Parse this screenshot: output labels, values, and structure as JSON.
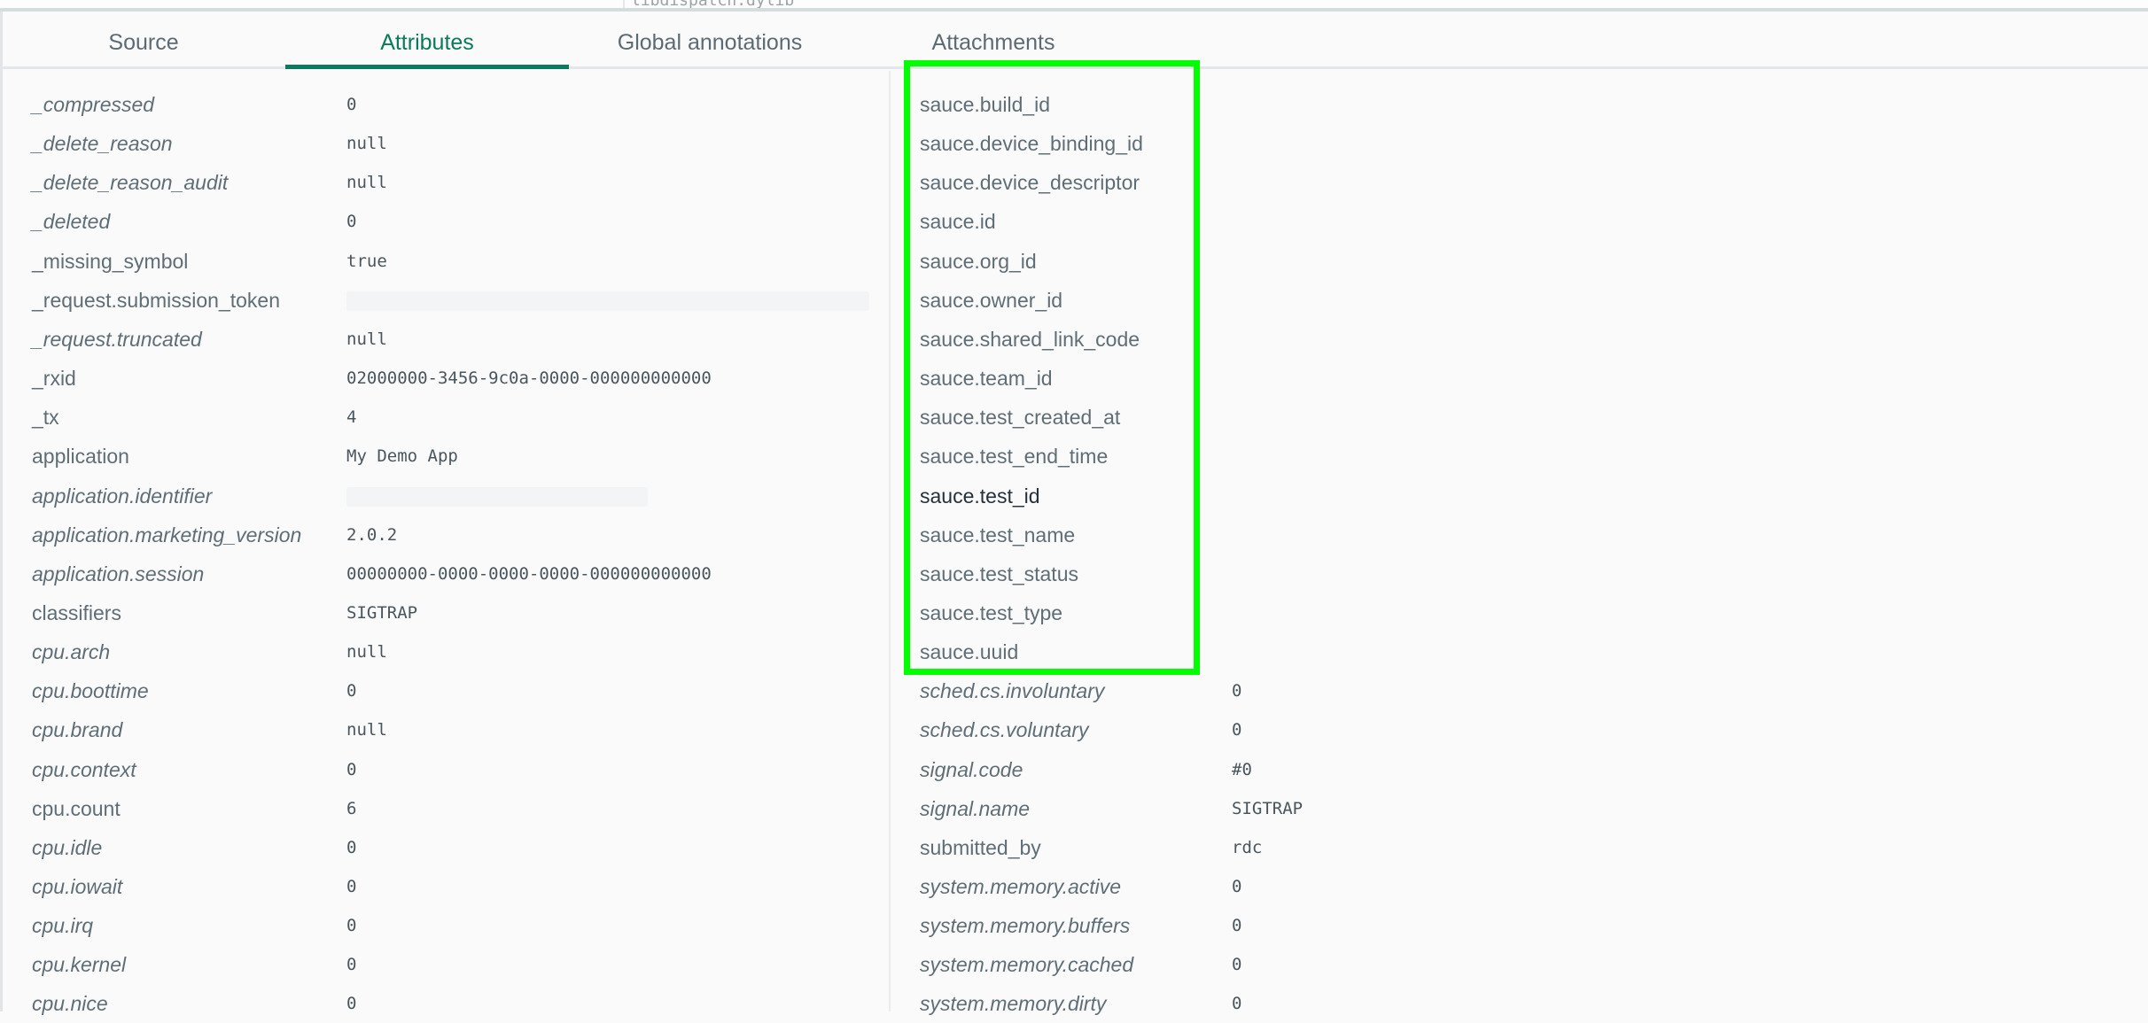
{
  "top_strip": {
    "clipped_text": "libdispatch.dylib"
  },
  "tabs": [
    {
      "label": "Source",
      "active": false
    },
    {
      "label": "Attributes",
      "active": true
    },
    {
      "label": "Global annotations",
      "active": false
    },
    {
      "label": "Attachments",
      "active": false
    }
  ],
  "colors": {
    "accent": "#0b7a5c",
    "highlight": "#00ff00"
  },
  "left_attributes": [
    {
      "key": "_compressed",
      "value": "0",
      "italic": true
    },
    {
      "key": "_delete_reason",
      "value": "null",
      "italic": true
    },
    {
      "key": "_delete_reason_audit",
      "value": "null",
      "italic": true
    },
    {
      "key": "_deleted",
      "value": "0",
      "italic": true
    },
    {
      "key": "_missing_symbol",
      "value": "true",
      "italic": false
    },
    {
      "key": "_request.submission_token",
      "value": null,
      "redacted": true,
      "italic": false
    },
    {
      "key": "_request.truncated",
      "value": "null",
      "italic": true
    },
    {
      "key": "_rxid",
      "value": "02000000-3456-9c0a-0000-000000000000",
      "italic": false
    },
    {
      "key": "_tx",
      "value": "4",
      "italic": false
    },
    {
      "key": "application",
      "value": "My Demo App",
      "italic": false
    },
    {
      "key": "application.identifier",
      "value": null,
      "redacted": true,
      "italic": true
    },
    {
      "key": "application.marketing_version",
      "value": "2.0.2",
      "italic": true
    },
    {
      "key": "application.session",
      "value": "00000000-0000-0000-0000-000000000000",
      "italic": true
    },
    {
      "key": "classifiers",
      "value": "SIGTRAP",
      "italic": false
    },
    {
      "key": "cpu.arch",
      "value": "null",
      "italic": true
    },
    {
      "key": "cpu.boottime",
      "value": "0",
      "italic": true
    },
    {
      "key": "cpu.brand",
      "value": "null",
      "italic": true
    },
    {
      "key": "cpu.context",
      "value": "0",
      "italic": true
    },
    {
      "key": "cpu.count",
      "value": "6",
      "italic": false
    },
    {
      "key": "cpu.idle",
      "value": "0",
      "italic": true
    },
    {
      "key": "cpu.iowait",
      "value": "0",
      "italic": true
    },
    {
      "key": "cpu.irq",
      "value": "0",
      "italic": true
    },
    {
      "key": "cpu.kernel",
      "value": "0",
      "italic": true
    },
    {
      "key": "cpu.nice",
      "value": "0",
      "italic": true
    }
  ],
  "right_attributes": [
    {
      "key": "sauce.build_id",
      "value": null,
      "italic": false
    },
    {
      "key": "sauce.device_binding_id",
      "value": null,
      "italic": false
    },
    {
      "key": "sauce.device_descriptor",
      "value": null,
      "italic": false
    },
    {
      "key": "sauce.id",
      "value": null,
      "italic": false
    },
    {
      "key": "sauce.org_id",
      "value": null,
      "italic": false
    },
    {
      "key": "sauce.owner_id",
      "value": null,
      "italic": false
    },
    {
      "key": "sauce.shared_link_code",
      "value": null,
      "italic": false
    },
    {
      "key": "sauce.team_id",
      "value": null,
      "italic": false
    },
    {
      "key": "sauce.test_created_at",
      "value": null,
      "italic": false
    },
    {
      "key": "sauce.test_end_time",
      "value": null,
      "italic": false
    },
    {
      "key": "sauce.test_id",
      "value": null,
      "italic": false,
      "hovered": true
    },
    {
      "key": "sauce.test_name",
      "value": null,
      "italic": false
    },
    {
      "key": "sauce.test_status",
      "value": null,
      "italic": false
    },
    {
      "key": "sauce.test_type",
      "value": null,
      "italic": false
    },
    {
      "key": "sauce.uuid",
      "value": null,
      "italic": false
    },
    {
      "key": "sched.cs.involuntary",
      "value": "0",
      "italic": true
    },
    {
      "key": "sched.cs.voluntary",
      "value": "0",
      "italic": true
    },
    {
      "key": "signal.code",
      "value": "#0",
      "italic": true
    },
    {
      "key": "signal.name",
      "value": "SIGTRAP",
      "italic": true
    },
    {
      "key": "submitted_by",
      "value": "rdc",
      "italic": false
    },
    {
      "key": "system.memory.active",
      "value": "0",
      "italic": true
    },
    {
      "key": "system.memory.buffers",
      "value": "0",
      "italic": true
    },
    {
      "key": "system.memory.cached",
      "value": "0",
      "italic": true
    },
    {
      "key": "system.memory.dirty",
      "value": "0",
      "italic": true
    }
  ]
}
